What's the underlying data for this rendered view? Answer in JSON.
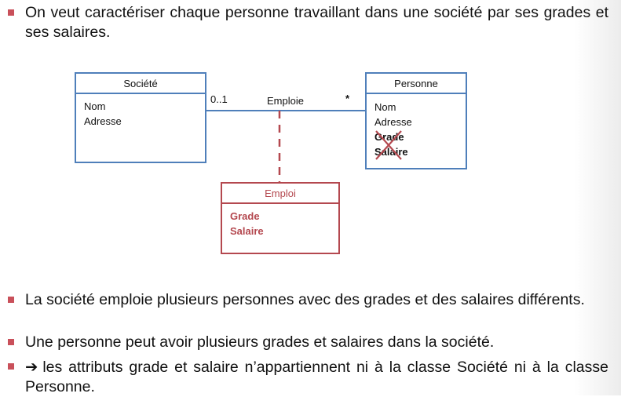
{
  "bullets": {
    "intro": "On veut caractériser chaque personne travaillant dans une société par ses grades et ses salaires.",
    "b1": "La société emploie plusieurs personnes avec des grades et des salaires différents.",
    "b2": "Une personne peut avoir plusieurs grades et salaires dans la société.",
    "b3_arrow": "➔",
    "b3": "les attributs grade et salaire n’appartiennent ni à la classe Société ni à la classe Personne."
  },
  "diagram": {
    "societe": {
      "name": "Société",
      "attrs": [
        "Nom",
        "Adresse"
      ]
    },
    "personne": {
      "name": "Personne",
      "attrs": [
        "Nom",
        "Adresse"
      ],
      "struck_attrs": [
        "Grade",
        "Salaire"
      ]
    },
    "emploi": {
      "name": "Emploi",
      "attrs": [
        "Grade",
        "Salaire"
      ]
    },
    "association": {
      "name": "Emploie",
      "mult_left": "0..1",
      "mult_right": "*"
    },
    "colors": {
      "class_border": "#4f7fba",
      "assoc_class": "#b4484f",
      "strike": "#b4484f",
      "bullet": "#c9505a"
    }
  }
}
